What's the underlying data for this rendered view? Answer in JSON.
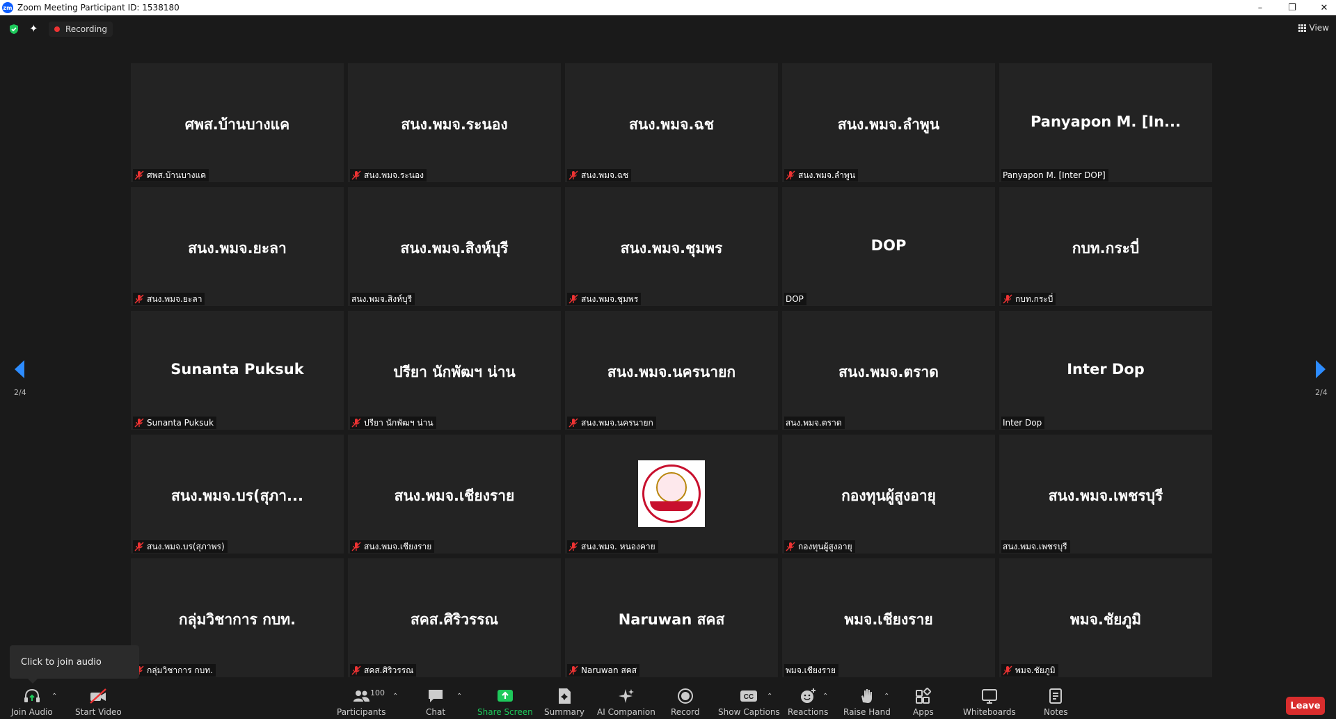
{
  "window": {
    "title": "Zoom Meeting Participant ID: 1538180",
    "logo_text": "zm",
    "minimize": "–",
    "restore": "❐",
    "close": "✕"
  },
  "topbar": {
    "recording_label": "Recording",
    "view_label": "View",
    "sparkle_glyph": "✦"
  },
  "gallery": {
    "page_indicator": "2/4",
    "tiles": [
      {
        "name": "ศพส.บ้านบางแค",
        "label": "ศพส.บ้านบางแค",
        "muted": true
      },
      {
        "name": "สนง.พมจ.ระนอง",
        "label": "สนง.พมจ.ระนอง",
        "muted": true
      },
      {
        "name": "สนง.พมจ.ฉช",
        "label": "สนง.พมจ.ฉช",
        "muted": true
      },
      {
        "name": "สนง.พมจ.ลำพูน",
        "label": "สนง.พมจ.ลำพูน",
        "muted": true
      },
      {
        "name": "Panyapon M. [In...",
        "label": "Panyapon M. [Inter DOP]",
        "muted": false
      },
      {
        "name": "สนง.พมจ.ยะลา",
        "label": "สนง.พมจ.ยะลา",
        "muted": true
      },
      {
        "name": "สนง.พมจ.สิงห์บุรี",
        "label": "สนง.พมจ.สิงห์บุรี",
        "muted": false
      },
      {
        "name": "สนง.พมจ.ชุมพร",
        "label": "สนง.พมจ.ชุมพร",
        "muted": true
      },
      {
        "name": "DOP",
        "label": "DOP",
        "muted": false
      },
      {
        "name": "กบท.กระบี่",
        "label": "กบท.กระบี่",
        "muted": true
      },
      {
        "name": "Sunanta Puksuk",
        "label": "Sunanta Puksuk",
        "muted": true
      },
      {
        "name": "ปรียา นักพัฒฯ น่าน",
        "label": "ปรียา นักพัฒฯ น่าน",
        "muted": true
      },
      {
        "name": "สนง.พมจ.นครนายก",
        "label": "สนง.พมจ.นครนายก",
        "muted": true
      },
      {
        "name": "สนง.พมจ.ตราด",
        "label": "สนง.พมจ.ตราด",
        "muted": false
      },
      {
        "name": "Inter Dop",
        "label": "Inter Dop",
        "muted": false
      },
      {
        "name": "สนง.พมจ.บร(สุภา...",
        "label": "สนง.พมจ.บร(สุภาพร)",
        "muted": true
      },
      {
        "name": "สนง.พมจ.เชียงราย",
        "label": "สนง.พมจ.เชียงราย",
        "muted": true
      },
      {
        "name": "",
        "label": "สนง.พมจ. หนองคาย",
        "muted": true,
        "logo": true
      },
      {
        "name": "กองทุนผู้สูงอายุ",
        "label": "กองทุนผู้สูงอายุ",
        "muted": true
      },
      {
        "name": "สนง.พมจ.เพชรบุรี",
        "label": "สนง.พมจ.เพชรบุรี",
        "muted": false
      },
      {
        "name": "กลุ่มวิชาการ กบท.",
        "label": "กลุ่มวิชาการ กบท.",
        "muted": true
      },
      {
        "name": "สคส.ศิริวรรณ",
        "label": "สคส.ศิริวรรณ",
        "muted": true
      },
      {
        "name": "Naruwan สคส",
        "label": "Naruwan สคส",
        "muted": true
      },
      {
        "name": "พมจ.เชียงราย",
        "label": "พมจ.เชียงราย",
        "muted": false
      },
      {
        "name": "พมจ.ชัยภูมิ",
        "label": "พมจ.ชัยภูมิ",
        "muted": true
      }
    ]
  },
  "tooltip": {
    "text": "Click to join audio"
  },
  "toolbar": {
    "join_audio": "Join Audio",
    "start_video": "Start Video",
    "participants": "Participants",
    "participants_count": "100",
    "chat": "Chat",
    "share_screen": "Share Screen",
    "summary": "Summary",
    "ai_companion": "AI Companion",
    "record": "Record",
    "show_captions": "Show Captions",
    "captions_glyph": "CC",
    "reactions": "Reactions",
    "raise_hand": "Raise Hand",
    "apps": "Apps",
    "whiteboards": "Whiteboards",
    "notes": "Notes",
    "leave": "Leave",
    "caret": "⌃",
    "accent_green": "#1ec95b",
    "leave_color": "#d92d2d"
  }
}
